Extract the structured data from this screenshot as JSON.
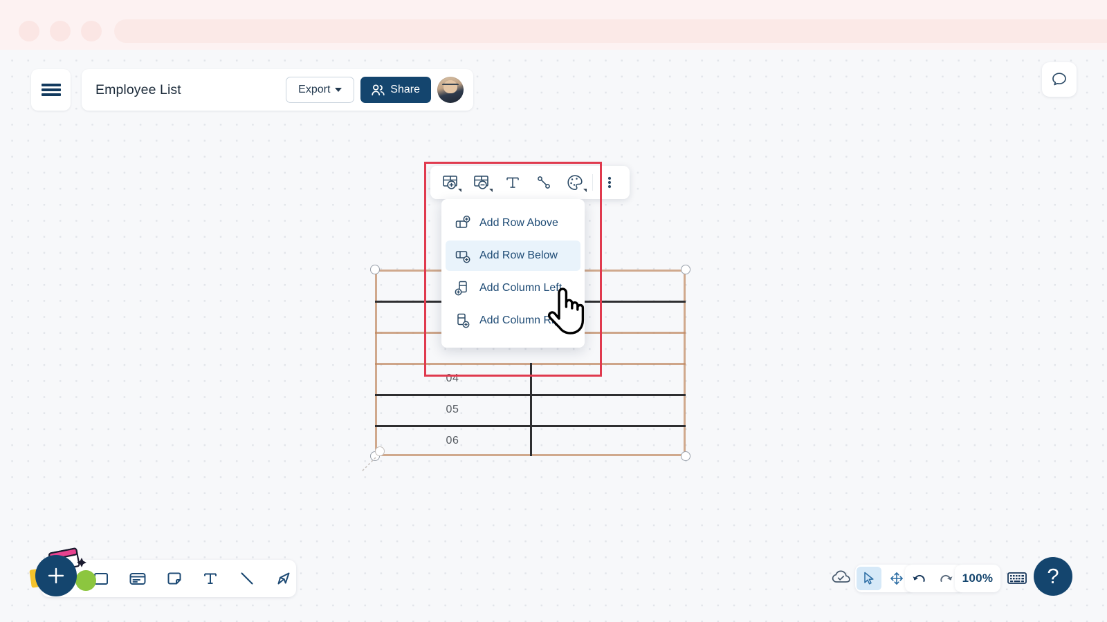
{
  "browser": {
    "traffic_lights": [
      "close",
      "minimize",
      "maximize"
    ],
    "url_value": "",
    "url_placeholder": ""
  },
  "header": {
    "menu_icon": "hamburger-icon",
    "doc_title": "Employee List",
    "export_label": "Export",
    "export_caret_icon": "chevron-down-icon",
    "share_label": "Share",
    "share_icon": "people-icon",
    "avatar_alt": "User avatar",
    "chat_icon": "chat-bubble-icon"
  },
  "element_toolbar": {
    "items": [
      {
        "name": "add-table-cells-icon",
        "label": "Add cells"
      },
      {
        "name": "remove-table-cells-icon",
        "label": "Remove cells"
      },
      {
        "name": "text-icon",
        "label": "Text"
      },
      {
        "name": "connector-line-icon",
        "label": "Connector"
      },
      {
        "name": "color-palette-icon",
        "label": "Colors"
      },
      {
        "name": "more-options-icon",
        "label": "More"
      }
    ]
  },
  "context_menu": {
    "items": [
      {
        "label": "Add Row Above",
        "icon": "add-row-above-icon",
        "active": false
      },
      {
        "label": "Add Row Below",
        "icon": "add-row-below-icon",
        "active": true
      },
      {
        "label": "Add Column Left",
        "icon": "add-column-left-icon",
        "active": false
      },
      {
        "label": "Add Column Right",
        "icon": "add-column-right-icon",
        "active": false
      }
    ]
  },
  "table_shape": {
    "rows": 6,
    "columns": 2,
    "visible_cell_labels": [
      "04",
      "05",
      "06"
    ],
    "border_color": "#c08a63",
    "gridline_color": "#2e2e30",
    "handles": [
      "top-left",
      "top-right",
      "bottom-left",
      "bottom-right",
      "resize"
    ]
  },
  "annotation": {
    "shape": "rectangle",
    "color": "#e03a4e"
  },
  "cursor": {
    "type": "pointing-hand"
  },
  "create_toolbar": {
    "add_label": "+",
    "tools": [
      {
        "name": "shape-rectangle-icon",
        "label": "Rectangle"
      },
      {
        "name": "card-icon",
        "label": "Card"
      },
      {
        "name": "sticky-note-icon",
        "label": "Note"
      },
      {
        "name": "text-tool-icon",
        "label": "Text"
      },
      {
        "name": "line-tool-icon",
        "label": "Line"
      },
      {
        "name": "marker-pen-icon",
        "label": "Marker"
      }
    ]
  },
  "status_bar": {
    "save_state_icon": "cloud-check-icon",
    "select_tool_icon": "cursor-arrow-icon",
    "pan_tool_icon": "move-arrows-icon",
    "undo_icon": "undo-arrow-icon",
    "redo_icon": "redo-arrow-icon",
    "zoom_level": "100%",
    "keyboard_icon": "keyboard-icon",
    "help_label": "?"
  },
  "colors": {
    "brand_navy": "#14456e",
    "annotation_red": "#e03a4e",
    "menu_highlight": "#e9f3fb",
    "canvas_bg": "#f7f8fa",
    "chrome_pink": "#fdf2f2"
  }
}
